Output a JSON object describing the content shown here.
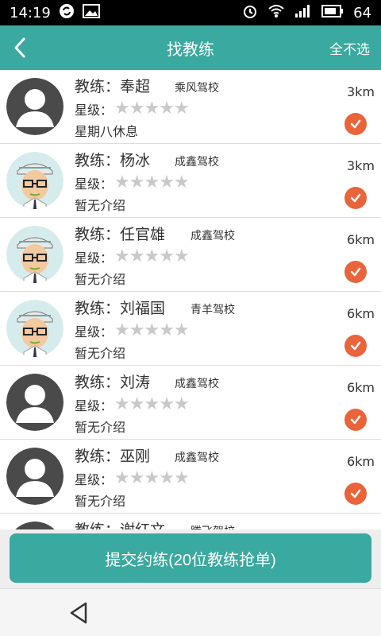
{
  "status": {
    "time": "14:19",
    "battery": "64"
  },
  "appbar": {
    "title": "找教练",
    "deselect_all": "全不选"
  },
  "labels": {
    "coach_prefix": "教练：",
    "rating_prefix": "星级："
  },
  "coaches": [
    {
      "name": "奉超",
      "school": "乘风驾校",
      "intro": "星期八休息",
      "distance": "3km",
      "rating": 0,
      "avatar": "default",
      "selected": true
    },
    {
      "name": "杨冰",
      "school": "成鑫驾校",
      "intro": "暂无介绍",
      "distance": "3km",
      "rating": 0,
      "avatar": "cartoon",
      "selected": true
    },
    {
      "name": "任官雄",
      "school": "成鑫驾校",
      "intro": "暂无介绍",
      "distance": "6km",
      "rating": 0,
      "avatar": "cartoon",
      "selected": true
    },
    {
      "name": "刘福国",
      "school": "青羊驾校",
      "intro": "暂无介绍",
      "distance": "6km",
      "rating": 0,
      "avatar": "cartoon",
      "selected": true
    },
    {
      "name": "刘涛",
      "school": "成鑫驾校",
      "intro": "暂无介绍",
      "distance": "6km",
      "rating": 0,
      "avatar": "default",
      "selected": true
    },
    {
      "name": "巫刚",
      "school": "成鑫驾校",
      "intro": "暂无介绍",
      "distance": "6km",
      "rating": 0,
      "avatar": "default",
      "selected": true
    },
    {
      "name": "谢红文",
      "school": "腾飞驾校",
      "intro": "",
      "distance": "",
      "rating": 0,
      "avatar": "default",
      "selected": true
    }
  ],
  "footer": {
    "submit_label": "提交约练(20位教练抢单)"
  },
  "colors": {
    "accent": "#3aa99f",
    "check": "#e9643a",
    "star_empty": "#c9c9c9"
  }
}
